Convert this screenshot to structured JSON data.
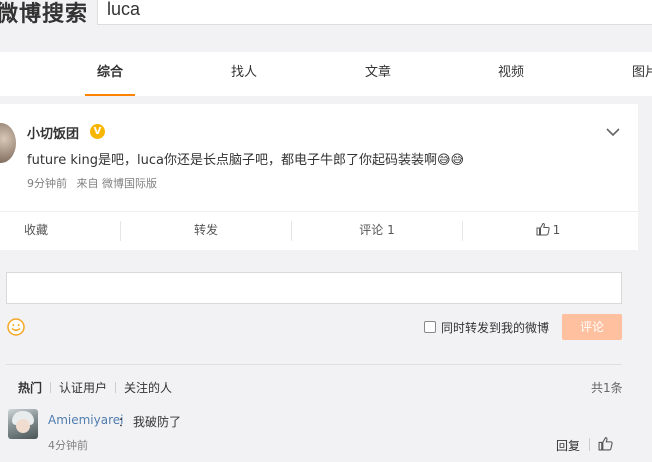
{
  "header": {
    "brand": "微博搜索",
    "search_value": "luca"
  },
  "tabs": [
    {
      "label": "综合",
      "active": true
    },
    {
      "label": "找人",
      "active": false
    },
    {
      "label": "文章",
      "active": false
    },
    {
      "label": "视频",
      "active": false
    },
    {
      "label": "图片",
      "active": false
    }
  ],
  "post": {
    "username": "小切饭团",
    "verified_icon": "v-badge-icon",
    "text": "future king是吧，luca你还是长点脑子吧，都电子牛郎了你起码装装啊😅😅",
    "time": "9分钟前",
    "source": "来自 微博国际版",
    "actions": {
      "favorite": "收藏",
      "repost": "转发",
      "comment": "评论 1",
      "like_count": "1"
    }
  },
  "comment_box": {
    "repost_label": "同时转发到我的微博",
    "submit_label": "评论"
  },
  "comments_section": {
    "filters": [
      "热门",
      "认证用户",
      "关注的人"
    ],
    "total": "共1条",
    "items": [
      {
        "user": "Amiemiyarei",
        "colon": "：",
        "text": "我破防了",
        "time": "4分钟前",
        "reply_label": "回复"
      }
    ]
  },
  "colors": {
    "accent": "#ff8200",
    "verified": "#f8b600",
    "link": "#507daf",
    "submit_disabled": "#ffc09f"
  }
}
